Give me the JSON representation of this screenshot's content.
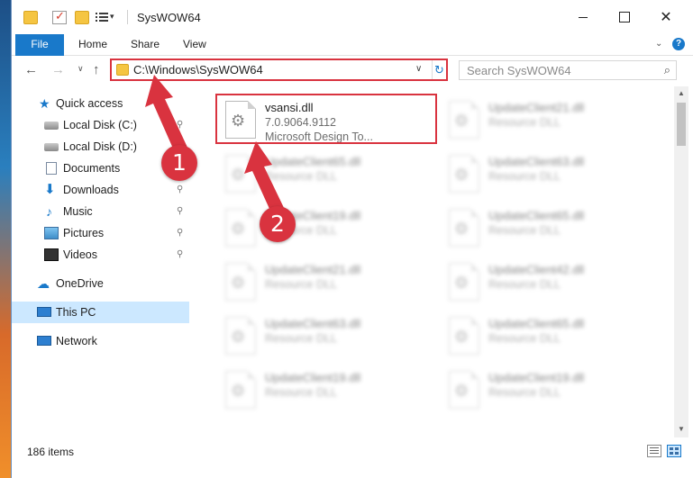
{
  "window": {
    "title": "SysWOW64",
    "dropdown_glyph": "▾",
    "min_label": "",
    "max_label": "",
    "close_glyph": "✕"
  },
  "ribbon": {
    "tabs": [
      {
        "label": "File"
      },
      {
        "label": "Home"
      },
      {
        "label": "Share"
      },
      {
        "label": "View"
      }
    ],
    "expand_glyph": "⌄",
    "help_glyph": "?"
  },
  "nav": {
    "back_glyph": "←",
    "forward_glyph": "→",
    "recent_glyph": "∨",
    "up_glyph": "↑"
  },
  "address": {
    "path": "C:\\Windows\\SysWOW64",
    "dropdown_glyph": "∨",
    "refresh_glyph": "↻"
  },
  "search": {
    "placeholder": "Search SysWOW64",
    "icon_glyph": "⌕"
  },
  "sidebar": {
    "items": [
      {
        "label": "Quick access",
        "icon": "star-icon",
        "pinned": false,
        "glyph": "★"
      },
      {
        "label": "Local Disk (C:)",
        "icon": "disk-icon",
        "pinned": true
      },
      {
        "label": "Local Disk (D:)",
        "icon": "disk-icon",
        "pinned": true
      },
      {
        "label": "Documents",
        "icon": "documents-icon",
        "pinned": true
      },
      {
        "label": "Downloads",
        "icon": "download-icon",
        "pinned": true,
        "glyph": "⬇"
      },
      {
        "label": "Music",
        "icon": "music-icon",
        "pinned": true,
        "glyph": "♪"
      },
      {
        "label": "Pictures",
        "icon": "pictures-icon",
        "pinned": true
      },
      {
        "label": "Videos",
        "icon": "videos-icon",
        "pinned": true
      },
      {
        "label": "OneDrive",
        "icon": "cloud-icon",
        "pinned": false,
        "glyph": "☁"
      },
      {
        "label": "This PC",
        "icon": "computer-icon",
        "pinned": false,
        "selected": true
      },
      {
        "label": "Network",
        "icon": "network-icon",
        "pinned": false
      }
    ],
    "pin_glyph": "📌"
  },
  "files": [
    {
      "name": "vsansi.dll",
      "version": "7.0.9064.9112",
      "description": "Microsoft Design To...",
      "blurred": false
    },
    {
      "name": "UpdateClient21.dll",
      "description": "Resource DLL",
      "blurred": true
    },
    {
      "name": "UpdateClient65.dll",
      "description": "Resource DLL",
      "blurred": true
    },
    {
      "name": "UpdateClient63.dll",
      "description": "Resource DLL",
      "blurred": true
    },
    {
      "name": "UpdateClient19.dll",
      "description": "Resource DLL",
      "blurred": true
    },
    {
      "name": "UpdateClient65.dll",
      "description": "Resource DLL",
      "blurred": true
    },
    {
      "name": "UpdateClient21.dll",
      "description": "Resource DLL",
      "blurred": true
    },
    {
      "name": "UpdateClient42.dll",
      "description": "Resource DLL",
      "blurred": true
    },
    {
      "name": "UpdateClient63.dll",
      "description": "Resource DLL",
      "blurred": true
    },
    {
      "name": "UpdateClient65.dll",
      "description": "Resource DLL",
      "blurred": true
    },
    {
      "name": "UpdateClient19.dll",
      "description": "Resource DLL",
      "blurred": true
    },
    {
      "name": "UpdateClient19.dll",
      "description": "Resource DLL",
      "blurred": true
    }
  ],
  "file_icon_glyph": "⚙",
  "annotations": {
    "step1": "1",
    "step2": "2",
    "color": "#d9333f"
  },
  "status": {
    "item_count": "186 items"
  },
  "scroll": {
    "up_glyph": "▲",
    "down_glyph": "▼"
  },
  "colors": {
    "accent": "#1979ca",
    "selection": "#cce8ff",
    "highlight": "#d9333f"
  }
}
